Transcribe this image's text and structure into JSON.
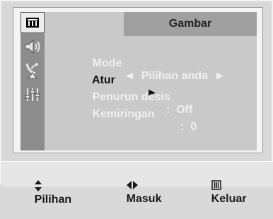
{
  "menu": {
    "title": "Gambar",
    "sidebar": [
      {
        "icon": "picture-icon",
        "active": true
      },
      {
        "icon": "sound-icon",
        "active": false
      },
      {
        "icon": "channel-antenna-icon",
        "active": false
      },
      {
        "icon": "setup-sliders-icon",
        "active": false
      }
    ],
    "rows": [
      {
        "label": "Mode",
        "value": "◄  Pilihan anda  ►",
        "state": "disabled"
      },
      {
        "label": "Atur",
        "value": "►",
        "state": "selected"
      },
      {
        "label": "Penurun desis",
        "value": ":  Off",
        "state": "disabled"
      },
      {
        "label": "Kemiringan",
        "value": ":  0",
        "state": "disabled"
      }
    ]
  },
  "footer": {
    "move_label": "Pilihan",
    "enter_label": "Masuk",
    "exit_label": "Keluar"
  },
  "colors": {
    "panel": "#c9c9c9",
    "title_bar": "#a0a0a0",
    "sidebar": "#8d8d8d",
    "active_text": "#111111",
    "dim_text": "#f0f0f0"
  }
}
